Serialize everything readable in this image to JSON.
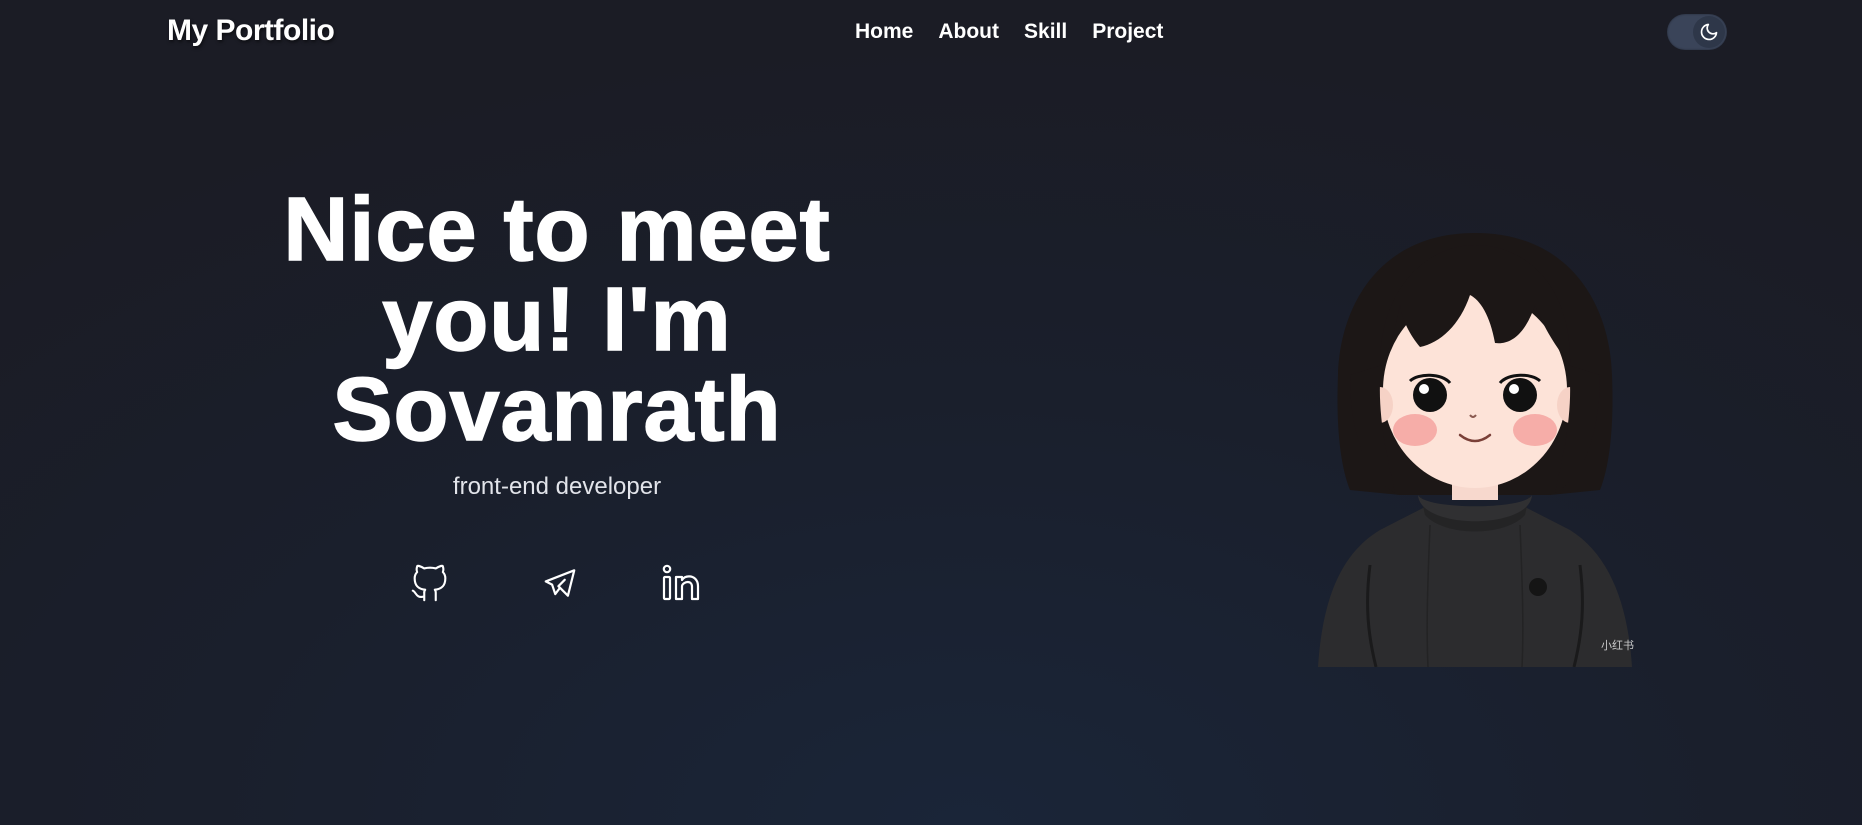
{
  "header": {
    "brand": "My Portfolio",
    "nav": [
      {
        "label": "Home"
      },
      {
        "label": "About"
      },
      {
        "label": "Skill"
      },
      {
        "label": "Project"
      }
    ],
    "theme_toggle": {
      "icon": "moon-icon",
      "mode": "dark"
    }
  },
  "hero": {
    "title": "Nice to meet you! I'm Sovanrath",
    "subtitle": "front-end developer",
    "socials": [
      {
        "icon": "github-icon"
      },
      {
        "icon": "telegram-icon"
      },
      {
        "icon": "linkedin-icon"
      }
    ],
    "avatar": {
      "icon": "cartoon-girl-avatar",
      "watermark": "小红书"
    }
  },
  "colors": {
    "background": "#1a1f2c",
    "text": "#ffffff",
    "toggle_track": "#3a4459"
  }
}
